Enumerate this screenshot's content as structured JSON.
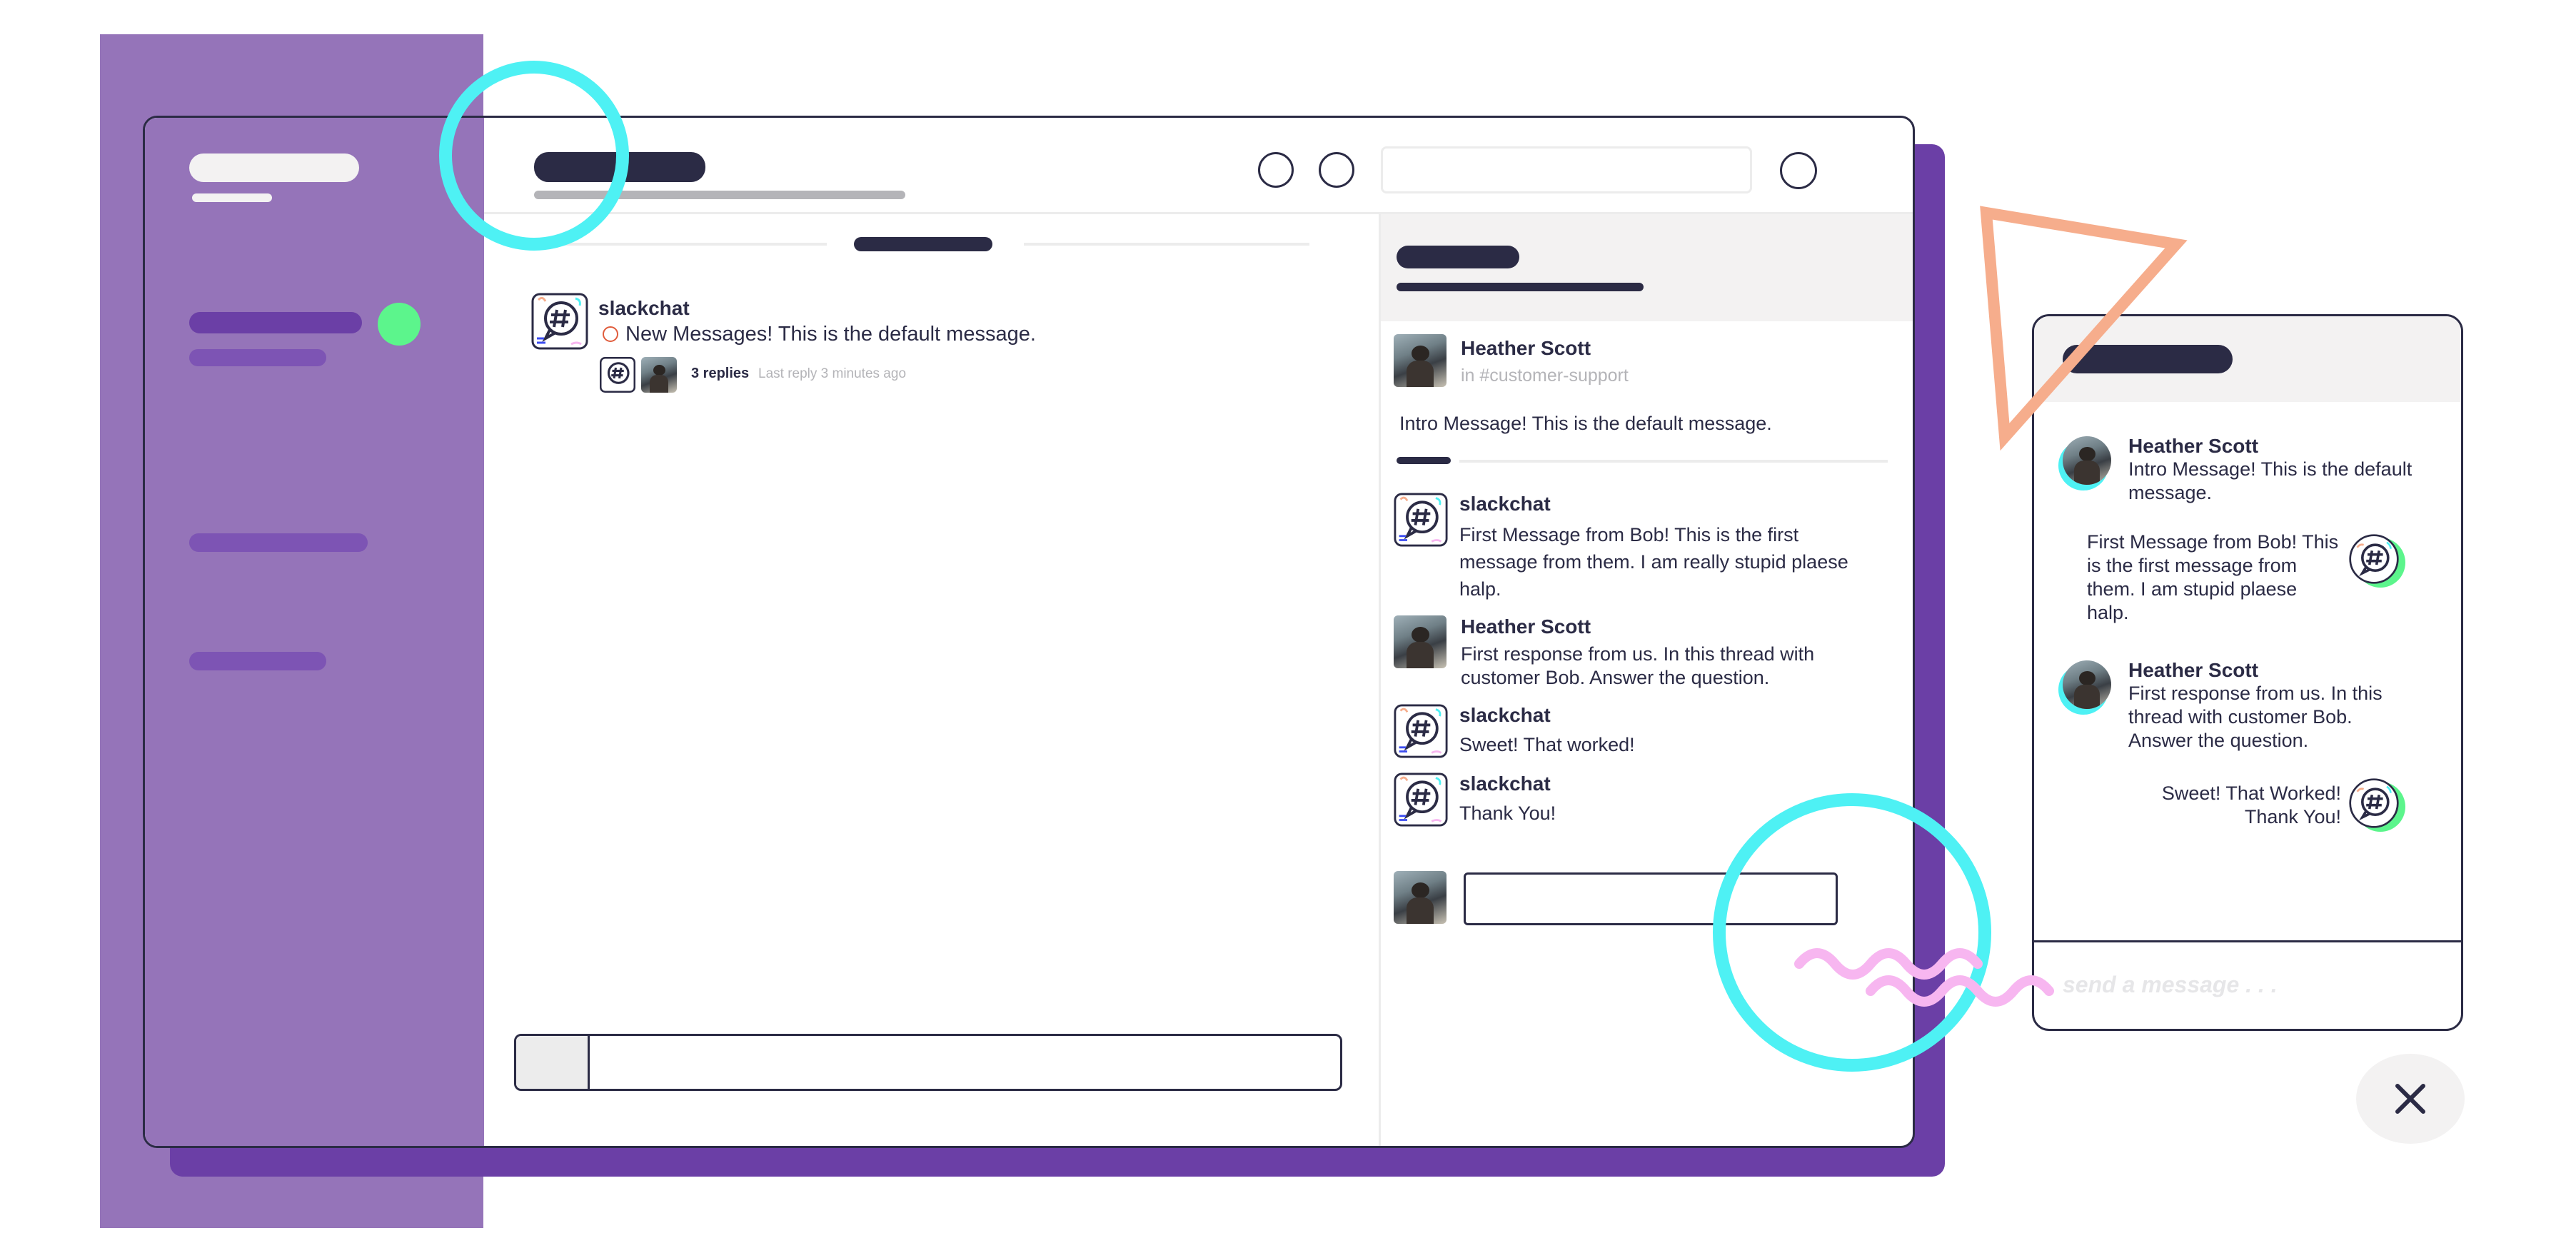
{
  "main_feed": {
    "message": {
      "author": "slackchat",
      "text": "New Messages! This is the default message.",
      "replies_count": "3 replies",
      "last_reply": "Last reply 3 minutes ago"
    }
  },
  "thread": {
    "intro": {
      "author": "Heather Scott",
      "channel": "in #customer-support",
      "text": "Intro Message! This is the default message."
    },
    "messages": [
      {
        "author": "slackchat",
        "text": "First Message from Bob! This is the first message from them. I am really stupid plaese halp."
      },
      {
        "author": "Heather Scott",
        "text": "First response from us. In this thread with customer Bob. Answer the question."
      },
      {
        "author": "slackchat",
        "text": "Sweet! That worked!"
      },
      {
        "author": "slackchat",
        "text": "Thank You!"
      }
    ]
  },
  "widget": {
    "messages": [
      {
        "author": "Heather Scott",
        "text": "Intro Message! This is the default message."
      },
      {
        "text": "First Message from Bob! This is the first message from them. I am stupid plaese halp."
      },
      {
        "author": "Heather Scott",
        "text": "First response from us. In this thread with customer Bob. Answer the question."
      },
      {
        "text": "Sweet! That Worked! Thank You!"
      }
    ],
    "input_placeholder": "send a message . . ."
  },
  "colors": {
    "sidebar": "#9574b9",
    "shadow": "#6b3fa6",
    "navy": "#2b2b45",
    "cyan": "#4ef1f4",
    "green": "#5cf58c",
    "peach": "#f6ad8c",
    "pink": "#f7b6f0"
  },
  "icons": [
    "slackchat-logo-icon",
    "close-icon",
    "circle-icon"
  ]
}
